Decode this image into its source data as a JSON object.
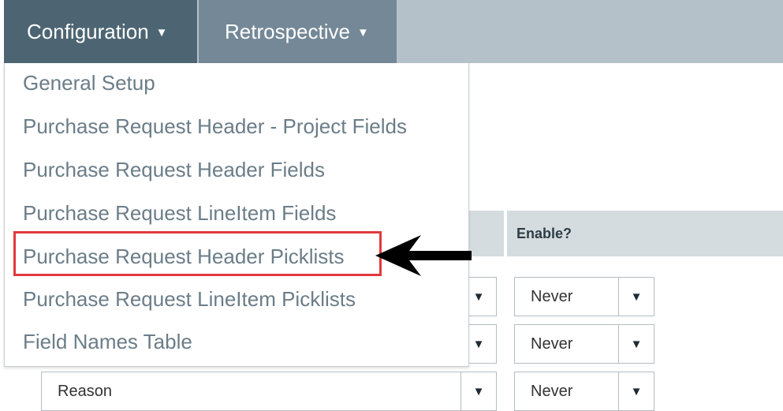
{
  "nav": {
    "configuration_label": "Configuration",
    "retrospective_label": "Retrospective"
  },
  "table": {
    "enable_header": "Enable?",
    "rows": [
      {
        "field_value": "",
        "enable_value": "Never"
      },
      {
        "field_value": "",
        "enable_value": "Never"
      },
      {
        "field_value": "Reason",
        "enable_value": "Never"
      }
    ]
  },
  "menu": {
    "items": [
      "General Setup",
      "Purchase Request Header - Project Fields",
      "Purchase Request Header Fields",
      "Purchase Request LineItem Fields",
      "Purchase Request Header Picklists",
      "Purchase Request LineItem Picklists",
      "Field Names Table"
    ],
    "highlighted_item": "Purchase Request Header Picklists"
  },
  "icons": {
    "caret": "caret-down-icon",
    "dropdown_triangle": "triangle-down-icon",
    "annotation_arrow": "arrow-left-icon"
  },
  "colors": {
    "nav_active": "#4d6573",
    "nav_inactive": "#748897",
    "nav_bar": "#b5c1c9",
    "menu_text": "#6b7d88",
    "highlight_border": "#e0393e"
  }
}
